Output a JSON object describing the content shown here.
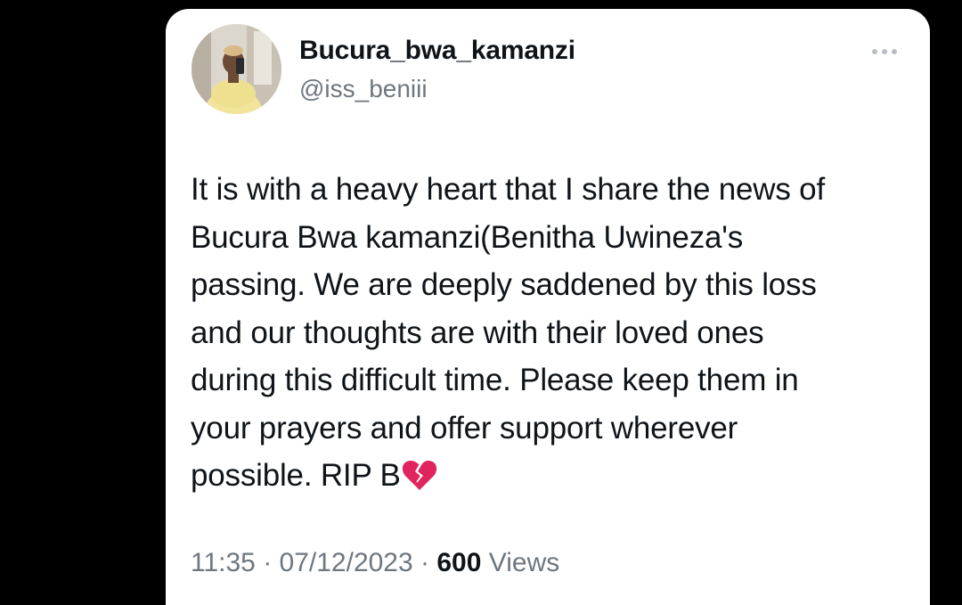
{
  "tweet": {
    "display_name": "Bucura_bwa_kamanzi",
    "handle": "@iss_beniii",
    "text_lines": [
      "It is with a heavy heart that I share the news of",
      "Bucura Bwa kamanzi(Benitha Uwineza's",
      "passing. We are deeply saddened by this loss",
      "and our thoughts are with their loved ones",
      "during this difficult time. Please keep them in",
      "your prayers and offer support wherever",
      "possible. RIP B"
    ],
    "emoji_icon": "broken-heart-icon",
    "time": "11:35",
    "separator": " · ",
    "date": "07/12/2023",
    "views_count": "600",
    "views_label": " Views"
  },
  "colors": {
    "background": "#000000",
    "card": "#ffffff",
    "primary_text": "#0f1419",
    "secondary_text": "#6d7780",
    "heart": "#e0245e"
  }
}
